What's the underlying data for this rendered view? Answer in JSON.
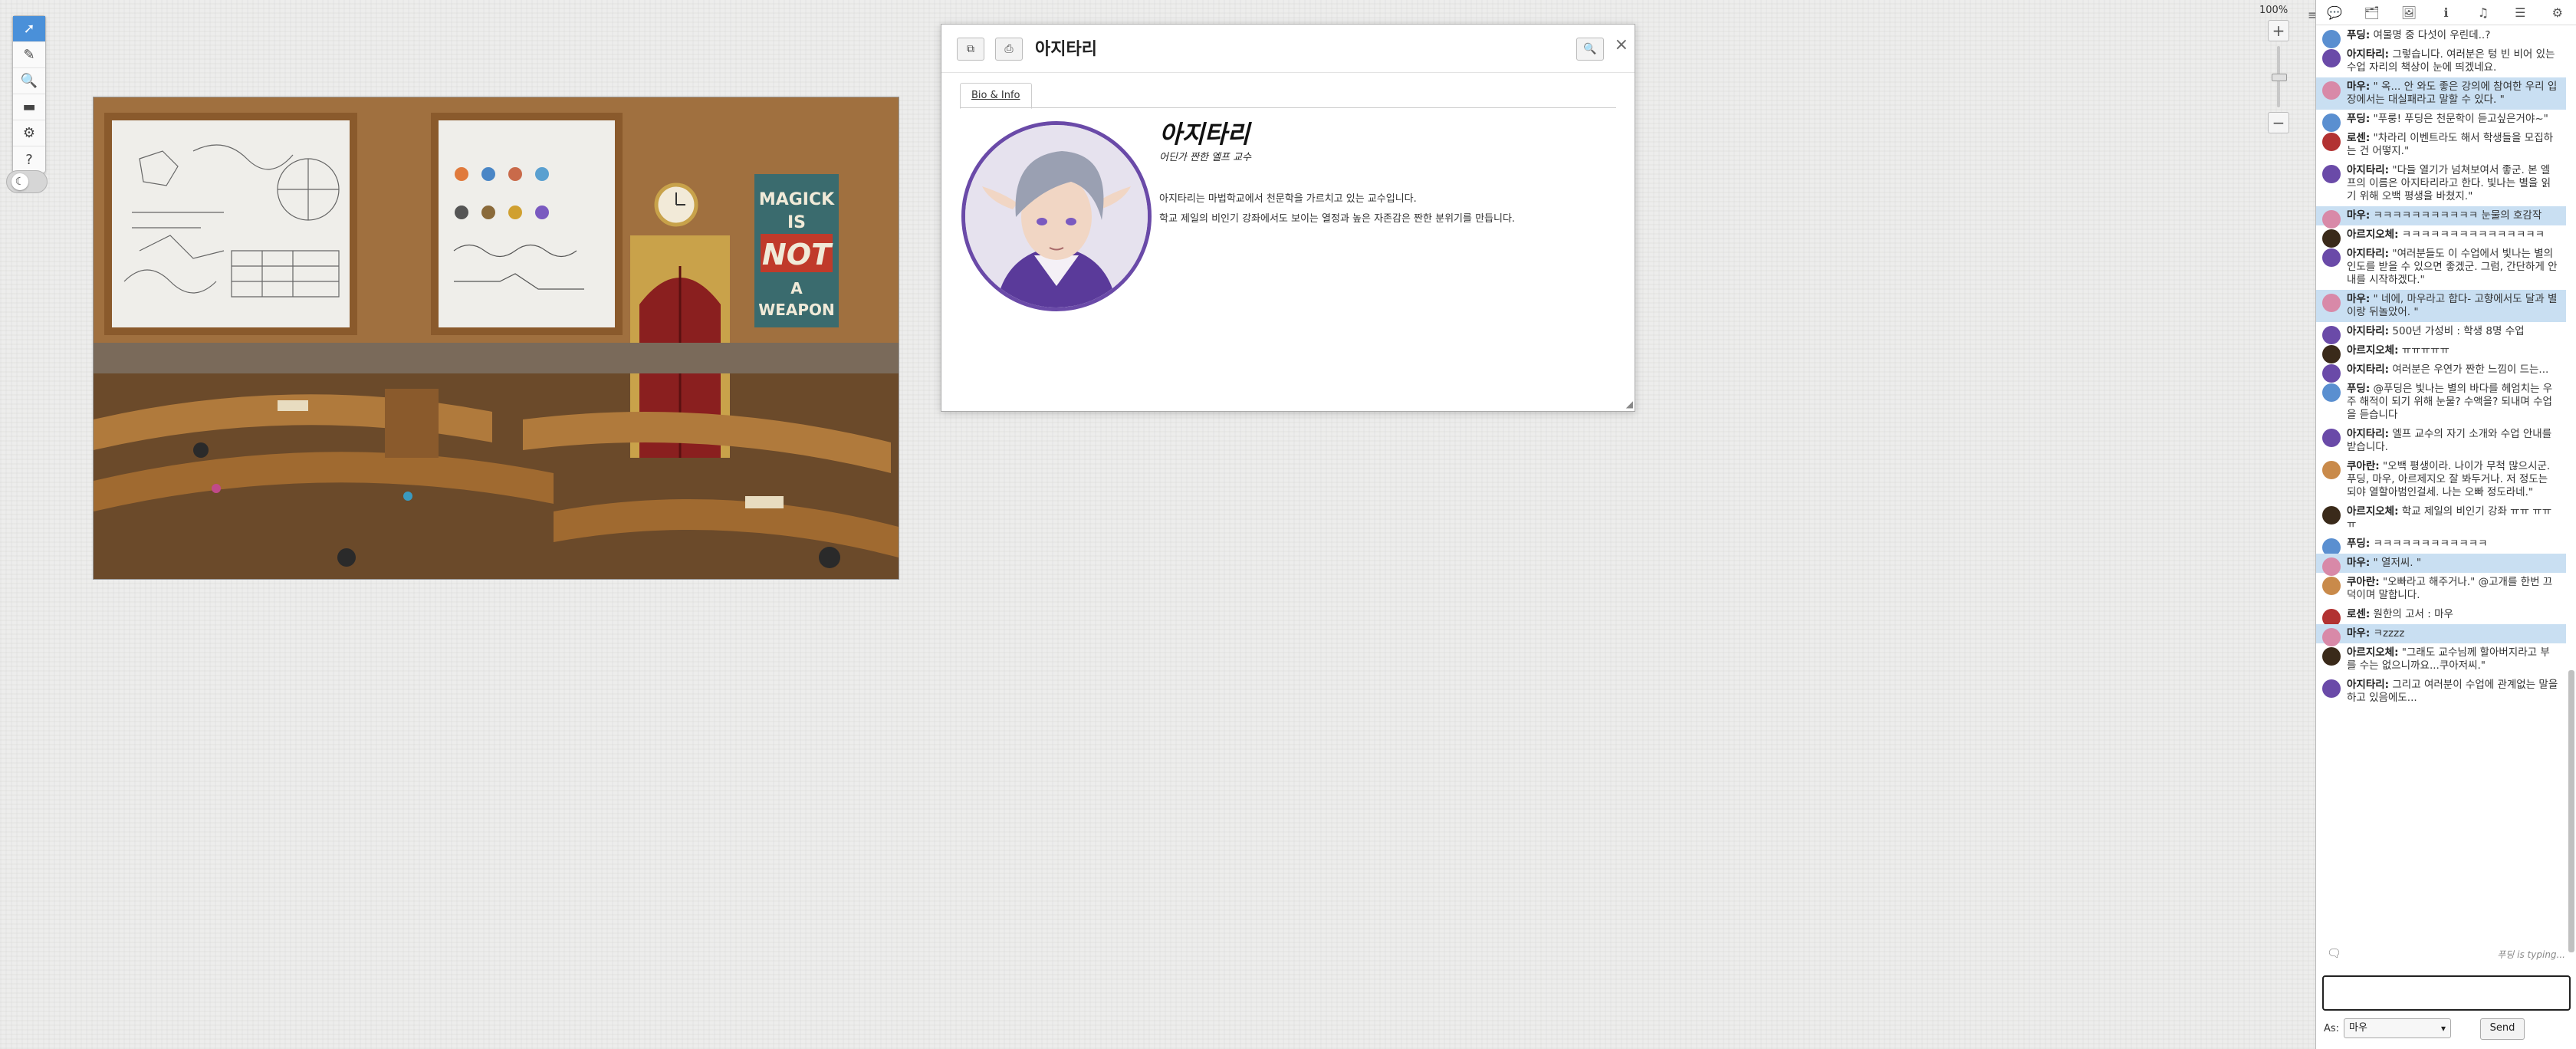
{
  "zoom": {
    "label": "100%"
  },
  "toolbar": {
    "tools": [
      {
        "name": "select-tool",
        "glyph": "➚"
      },
      {
        "name": "draw-tool",
        "glyph": "✎"
      },
      {
        "name": "zoom-tool",
        "glyph": "🔍"
      },
      {
        "name": "measure-tool",
        "glyph": "▬"
      },
      {
        "name": "tokens-tool",
        "glyph": "⚙"
      },
      {
        "name": "help-tool",
        "glyph": "?"
      }
    ],
    "dark_mode_glyph": "☾"
  },
  "scene": {
    "poster_lines": [
      "MAGICK",
      "IS",
      "NOT",
      "A",
      "WEAPON"
    ]
  },
  "dialog": {
    "title": "아지타리",
    "close": "×",
    "tab_label": "Bio & Info",
    "bio_name": "아지타리",
    "bio_sub": "어딘가 짠한 엘프 교수",
    "bio_p1": "아지타리는 마법학교에서 천문학을 가르치고 있는 교수입니다.",
    "bio_p2": "학교 제일의 비인기 강좌에서도 보이는 열정과 높은 자존감은 짠한 분위기를 만듭니다.",
    "resize": "◢"
  },
  "panel": {
    "tabs": [
      "💬",
      "🗂",
      "🖼",
      "ℹ",
      "♫",
      "☰",
      "⚙"
    ],
    "collapse": "≡",
    "messages": [
      {
        "who": "푸딩:",
        "text": "여물명 중 다섯이 우린데..?",
        "me": false,
        "color": "#5a8fd0"
      },
      {
        "who": "아지타리:",
        "text": "그렇습니다. 여러분은 텅 빈 비어 있는 수업 자리의 책상이 눈에 띄겠네요.",
        "me": false,
        "color": "#6a4aa8"
      },
      {
        "who": "마우:",
        "text": "\" 옥... 안 와도 좋은 강의에 참여한 우리 입장에서는 대실패라고 말할 수 있다. \"",
        "me": true,
        "color": "#d889a8"
      },
      {
        "who": "푸딩:",
        "text": "\"푸룽! 푸딩은 천문학이 듣고싶은거야~\"",
        "me": false,
        "color": "#5a8fd0"
      },
      {
        "who": "로센:",
        "text": "\"차라리 이벤트라도 해서 학생들을 모집하는 건 어떻지.\"",
        "me": false,
        "color": "#b23232"
      },
      {
        "who": "아지타리:",
        "text": "\"다들 열기가 넘쳐보여서 좋군. 본 엘프의 이름은 아지타리라고 한다. 빛나는 별을 읽기 위해 오백 평생을 바쳤지.\"",
        "me": false,
        "color": "#6a4aa8"
      },
      {
        "who": "마우:",
        "text": "ㅋㅋㅋㅋㅋㅋㅋㅋㅋㅋㅋ 눈물의 호감작",
        "me": true,
        "color": "#d889a8"
      },
      {
        "who": "아르지오체:",
        "text": "ㅋㅋㅋㅋㅋㅋㅋㅋㅋㅋㅋㅋㅋㅋㅋ",
        "me": false,
        "color": "#3a2a1a"
      },
      {
        "who": "아지타리:",
        "text": "\"여러분들도 이 수업에서 빛나는 별의 인도를 받을 수 있으면 좋겠군. 그럼, 간단하게 안내를 시작하겠다.\"",
        "me": false,
        "color": "#6a4aa8"
      },
      {
        "who": "마우:",
        "text": "\" 네에, 마우라고 합다- 고향에서도 달과 별이랑 뒤놀았어. \"",
        "me": true,
        "color": "#d889a8"
      },
      {
        "who": "아지타리:",
        "text": "500년 가성비 : 학생 8명 수업",
        "me": false,
        "color": "#6a4aa8"
      },
      {
        "who": "아르지오체:",
        "text": "ㅠㅠㅠㅠㅠ",
        "me": false,
        "color": "#3a2a1a"
      },
      {
        "who": "아지타리:",
        "text": "여러분은 우연가 짠한 느낌이 드는...",
        "me": false,
        "color": "#6a4aa8"
      },
      {
        "who": "푸딩:",
        "text": "@푸딩은 빛나는 별의 바다를 헤엄치는 우주 해적이 되기 위해 눈물? 수액을? 되내며 수업을 듣습니다",
        "me": false,
        "color": "#5a8fd0"
      },
      {
        "who": "아지타리:",
        "text": "엘프 교수의 자기 소개와 수업 안내를 받습니다.",
        "me": false,
        "color": "#6a4aa8"
      },
      {
        "who": "쿠아란:",
        "text": "\"오백 평생이라. 나이가 무척 많으시군. 푸딩, 마우, 아르제지오 잘 봐두거나. 저 정도는 되야 열할아범인걸세. 나는 오빠 정도라네.\"",
        "me": false,
        "color": "#c98a4a"
      },
      {
        "who": "아르지오체:",
        "text": "학교 제일의 비인기 강좌 ㅠㅠ ㅠㅠㅠ",
        "me": false,
        "color": "#3a2a1a"
      },
      {
        "who": "푸딩:",
        "text": "ㅋㅋㅋㅋㅋㅋㅋㅋㅋㅋㅋㅋ",
        "me": false,
        "color": "#5a8fd0"
      },
      {
        "who": "마우:",
        "text": "\" 열저씨. \"",
        "me": true,
        "color": "#d889a8"
      },
      {
        "who": "쿠아란:",
        "text": "\"오빠라고 해주거나.\" @고개를 한번 끄덕이며 말합니다.",
        "me": false,
        "color": "#c98a4a"
      },
      {
        "who": "로센:",
        "text": "원한의 고서 : 마우",
        "me": false,
        "color": "#b23232"
      },
      {
        "who": "마우:",
        "text": "ㅋzzzz",
        "me": true,
        "color": "#d889a8"
      },
      {
        "who": "아르지오체:",
        "text": "\"그래도 교수님께 할아버지라고 부를 수는 없으니까요...쿠아저씨.\"",
        "me": false,
        "color": "#3a2a1a"
      },
      {
        "who": "아지타리:",
        "text": "그리고 여러분이 수업에 관계없는 말을 하고 있음에도...",
        "me": false,
        "color": "#6a4aa8"
      }
    ],
    "typing": "푸딩 is typing...",
    "as_label": "As:",
    "as_value": "마우",
    "send_label": "Send"
  }
}
